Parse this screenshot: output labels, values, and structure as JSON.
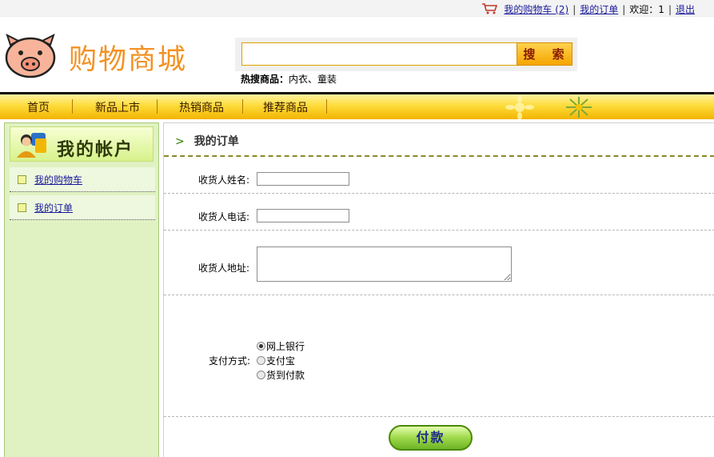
{
  "topbar": {
    "cart_link": "我的购物车",
    "cart_count": "(2)",
    "orders_link": "我的订单",
    "welcome": "欢迎：1",
    "logout": "退出"
  },
  "header": {
    "brand": "购物商城",
    "search": {
      "value": "",
      "button_label": "搜 索"
    },
    "hot_label": "热搜商品：",
    "hot_items": "内衣、童装"
  },
  "nav": {
    "items": [
      "首页",
      "新品上市",
      "热销商品",
      "推荐商品"
    ]
  },
  "sidebar": {
    "title": "我的帐户",
    "items": [
      "我的购物车",
      "我的订单"
    ]
  },
  "main": {
    "breadcrumb": "我的订单",
    "form": {
      "name_label": "收货人姓名:",
      "phone_label": "收货人电话:",
      "address_label": "收货人地址:",
      "payment_label": "支付方式:",
      "name_value": "",
      "phone_value": "",
      "address_value": "",
      "payment_options": [
        "网上银行",
        "支付宝",
        "货到付款"
      ],
      "payment_selected": "网上银行",
      "submit_label": "付款"
    }
  },
  "colors": {
    "brand": "#f39224",
    "nav_gradient_top": "#fff2a0",
    "nav_gradient_bottom": "#f2b400",
    "sidebar_bg": "#e0f2c2",
    "link": "#1a1a9a"
  }
}
